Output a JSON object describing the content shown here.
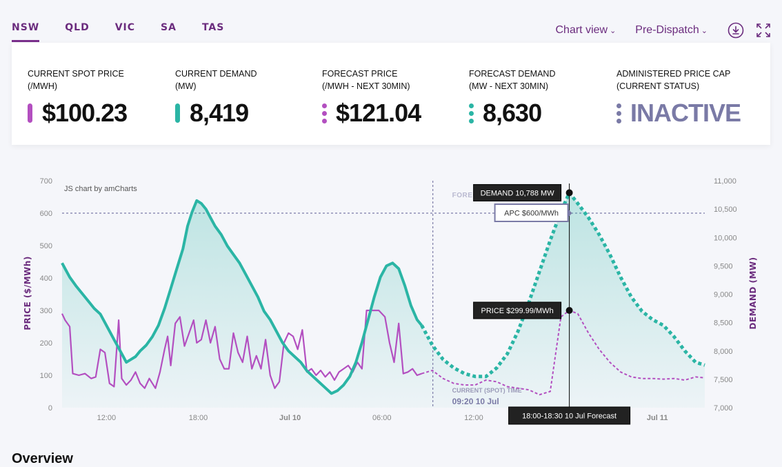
{
  "tabs": [
    "NSW",
    "QLD",
    "VIC",
    "SA",
    "TAS"
  ],
  "toolbar": {
    "chart_view_label": "Chart view",
    "dispatch_label": "Pre-Dispatch"
  },
  "cards": [
    {
      "label1": "CURRENT SPOT PRICE",
      "label2": "(/MWh)",
      "value": "$100.23",
      "marker": "bar",
      "color": "#b34fc0"
    },
    {
      "label1": "CURRENT DEMAND",
      "label2": "(MW)",
      "value": "8,419",
      "marker": "bar",
      "color": "#2bb5a5"
    },
    {
      "label1": "FORECAST PRICE",
      "label2": "(/MWh - NEXT 30MIN)",
      "value": "$121.04",
      "marker": "dots",
      "color": "#b34fc0"
    },
    {
      "label1": "FORECAST DEMAND",
      "label2": "(MW - NEXT 30MIN)",
      "value": "8,630",
      "marker": "dots",
      "color": "#2bb5a5"
    },
    {
      "label1": "ADMINISTERED PRICE CAP",
      "label2": "(CURRENT STATUS)",
      "value": "INACTIVE",
      "marker": "dots",
      "color": "#7a7aa6"
    }
  ],
  "chart_data": {
    "type": "line",
    "credit": "JS chart by amCharts",
    "ylabel_left": "PRICE ($/MWh)",
    "ylabel_right": "DEMAND (MW)",
    "ylim_left": [
      0,
      700
    ],
    "ylim_right": [
      7000,
      11000
    ],
    "yticks_left": [
      "0",
      "100",
      "200",
      "300",
      "400",
      "500",
      "600",
      "700"
    ],
    "yticks_right": [
      "7,000",
      "7,500",
      "8,000",
      "8,500",
      "9,000",
      "9,500",
      "10,000",
      "10,500",
      "11,000"
    ],
    "xticks": [
      {
        "label": "12:00",
        "t": 12,
        "bold": false
      },
      {
        "label": "18:00",
        "t": 18,
        "bold": false
      },
      {
        "label": "Jul 10",
        "t": 24,
        "bold": true
      },
      {
        "label": "06:00",
        "t": 30,
        "bold": false
      },
      {
        "label": "12:00",
        "t": 36,
        "bold": false
      },
      {
        "label": "Jul 11",
        "t": 48,
        "bold": true
      }
    ],
    "apc_line": 600,
    "current_time_label": "CURRENT (SPOT) TIME",
    "current_time_value": "09:20 10 Jul",
    "current_t": 33.33,
    "forecast_label": "FORECAST",
    "cursor_label": "18:00-18:30 10 Jul Forecast",
    "cursor_t": 42.25,
    "tooltip_demand": "DEMAND 10,788 MW",
    "tooltip_apc": "APC $600/MWh",
    "tooltip_price": "PRICE $299.99/MWh",
    "series": [
      {
        "name": "Demand",
        "axis": "right",
        "color": "#2bb5a5",
        "actual": [
          [
            9.1,
            9550
          ],
          [
            9.3,
            9450
          ],
          [
            9.6,
            9300
          ],
          [
            10.0,
            9150
          ],
          [
            10.3,
            9050
          ],
          [
            10.6,
            8950
          ],
          [
            10.9,
            8850
          ],
          [
            11.2,
            8750
          ],
          [
            11.6,
            8650
          ],
          [
            11.9,
            8500
          ],
          [
            12.2,
            8350
          ],
          [
            12.5,
            8200
          ],
          [
            12.8,
            8050
          ],
          [
            13.1,
            7900
          ],
          [
            13.3,
            7800
          ],
          [
            13.6,
            7850
          ],
          [
            13.9,
            7900
          ],
          [
            14.2,
            8000
          ],
          [
            14.6,
            8100
          ],
          [
            15.0,
            8250
          ],
          [
            15.4,
            8450
          ],
          [
            15.8,
            8750
          ],
          [
            16.2,
            9100
          ],
          [
            16.6,
            9450
          ],
          [
            17.0,
            9800
          ],
          [
            17.3,
            10200
          ],
          [
            17.6,
            10450
          ],
          [
            17.9,
            10650
          ],
          [
            18.2,
            10600
          ],
          [
            18.5,
            10500
          ],
          [
            18.8,
            10350
          ],
          [
            19.1,
            10200
          ],
          [
            19.5,
            10050
          ],
          [
            19.9,
            9850
          ],
          [
            20.3,
            9700
          ],
          [
            20.7,
            9550
          ],
          [
            21.1,
            9350
          ],
          [
            21.5,
            9150
          ],
          [
            21.9,
            8950
          ],
          [
            22.3,
            8700
          ],
          [
            22.7,
            8550
          ],
          [
            23.1,
            8350
          ],
          [
            23.5,
            8150
          ],
          [
            23.9,
            8000
          ],
          [
            24.3,
            7900
          ],
          [
            24.7,
            7800
          ],
          [
            25.1,
            7650
          ],
          [
            25.5,
            7550
          ],
          [
            25.9,
            7450
          ],
          [
            26.3,
            7350
          ],
          [
            26.7,
            7250
          ],
          [
            27.1,
            7300
          ],
          [
            27.5,
            7400
          ],
          [
            27.9,
            7550
          ],
          [
            28.3,
            7800
          ],
          [
            28.7,
            8150
          ],
          [
            29.1,
            8550
          ],
          [
            29.5,
            8950
          ],
          [
            29.9,
            9300
          ],
          [
            30.3,
            9500
          ],
          [
            30.7,
            9550
          ],
          [
            31.1,
            9450
          ],
          [
            31.5,
            9150
          ],
          [
            31.9,
            8800
          ],
          [
            32.3,
            8550
          ],
          [
            32.6,
            8450
          ]
        ],
        "forecast": [
          [
            32.6,
            8450
          ],
          [
            33.3,
            8100
          ],
          [
            34.0,
            7850
          ],
          [
            34.7,
            7700
          ],
          [
            35.4,
            7600
          ],
          [
            36.1,
            7550
          ],
          [
            36.8,
            7550
          ],
          [
            37.5,
            7700
          ],
          [
            38.2,
            7950
          ],
          [
            38.9,
            8350
          ],
          [
            39.6,
            8850
          ],
          [
            40.3,
            9400
          ],
          [
            41.0,
            9950
          ],
          [
            41.7,
            10450
          ],
          [
            42.25,
            10788
          ],
          [
            42.8,
            10600
          ],
          [
            43.5,
            10350
          ],
          [
            44.2,
            10050
          ],
          [
            44.9,
            9700
          ],
          [
            45.6,
            9300
          ],
          [
            46.3,
            8950
          ],
          [
            47.0,
            8700
          ],
          [
            47.7,
            8550
          ],
          [
            48.4,
            8450
          ],
          [
            49.1,
            8250
          ],
          [
            49.8,
            8000
          ],
          [
            50.5,
            7800
          ],
          [
            51.1,
            7750
          ]
        ]
      },
      {
        "name": "Price",
        "axis": "left",
        "color": "#b34fc0",
        "actual": [
          [
            9.1,
            290
          ],
          [
            9.3,
            270
          ],
          [
            9.6,
            250
          ],
          [
            9.8,
            105
          ],
          [
            10.2,
            100
          ],
          [
            10.6,
            105
          ],
          [
            11.0,
            90
          ],
          [
            11.3,
            95
          ],
          [
            11.6,
            180
          ],
          [
            11.9,
            170
          ],
          [
            12.2,
            75
          ],
          [
            12.5,
            65
          ],
          [
            12.8,
            270
          ],
          [
            13.0,
            90
          ],
          [
            13.3,
            70
          ],
          [
            13.6,
            85
          ],
          [
            13.9,
            110
          ],
          [
            14.2,
            75
          ],
          [
            14.5,
            60
          ],
          [
            14.8,
            90
          ],
          [
            15.2,
            60
          ],
          [
            15.5,
            110
          ],
          [
            15.8,
            180
          ],
          [
            16.0,
            220
          ],
          [
            16.2,
            130
          ],
          [
            16.5,
            260
          ],
          [
            16.8,
            280
          ],
          [
            17.1,
            190
          ],
          [
            17.4,
            230
          ],
          [
            17.7,
            270
          ],
          [
            17.9,
            200
          ],
          [
            18.2,
            210
          ],
          [
            18.5,
            270
          ],
          [
            18.8,
            200
          ],
          [
            19.1,
            250
          ],
          [
            19.4,
            150
          ],
          [
            19.7,
            120
          ],
          [
            20.0,
            120
          ],
          [
            20.3,
            230
          ],
          [
            20.6,
            170
          ],
          [
            20.9,
            140
          ],
          [
            21.2,
            220
          ],
          [
            21.5,
            120
          ],
          [
            21.8,
            160
          ],
          [
            22.1,
            120
          ],
          [
            22.4,
            210
          ],
          [
            22.7,
            100
          ],
          [
            23.0,
            60
          ],
          [
            23.3,
            80
          ],
          [
            23.6,
            200
          ],
          [
            23.9,
            230
          ],
          [
            24.2,
            220
          ],
          [
            24.5,
            180
          ],
          [
            24.8,
            240
          ],
          [
            25.1,
            110
          ],
          [
            25.4,
            120
          ],
          [
            25.7,
            100
          ],
          [
            26.0,
            115
          ],
          [
            26.3,
            95
          ],
          [
            26.6,
            110
          ],
          [
            26.9,
            85
          ],
          [
            27.2,
            110
          ],
          [
            27.5,
            120
          ],
          [
            27.8,
            130
          ],
          [
            28.1,
            110
          ],
          [
            28.4,
            140
          ],
          [
            28.7,
            120
          ],
          [
            29.0,
            300
          ],
          [
            29.4,
            300
          ],
          [
            29.8,
            300
          ],
          [
            30.2,
            280
          ],
          [
            30.5,
            200
          ],
          [
            30.8,
            140
          ],
          [
            31.1,
            260
          ],
          [
            31.4,
            105
          ],
          [
            31.7,
            110
          ],
          [
            32.0,
            120
          ],
          [
            32.3,
            100
          ],
          [
            32.6,
            105
          ]
        ],
        "forecast": [
          [
            32.6,
            105
          ],
          [
            33.3,
            115
          ],
          [
            34.0,
            90
          ],
          [
            34.7,
            75
          ],
          [
            35.4,
            70
          ],
          [
            36.1,
            70
          ],
          [
            36.8,
            85
          ],
          [
            37.5,
            80
          ],
          [
            38.2,
            65
          ],
          [
            38.9,
            60
          ],
          [
            39.6,
            55
          ],
          [
            40.3,
            40
          ],
          [
            41.0,
            50
          ],
          [
            41.7,
            280
          ],
          [
            42.25,
            299.99
          ],
          [
            42.8,
            290
          ],
          [
            43.5,
            230
          ],
          [
            44.2,
            180
          ],
          [
            44.9,
            140
          ],
          [
            45.6,
            110
          ],
          [
            46.3,
            95
          ],
          [
            47.0,
            90
          ],
          [
            47.7,
            90
          ],
          [
            48.4,
            88
          ],
          [
            49.1,
            90
          ],
          [
            49.8,
            85
          ],
          [
            50.5,
            95
          ],
          [
            51.1,
            92
          ]
        ]
      }
    ]
  },
  "overview_label": "Overview"
}
